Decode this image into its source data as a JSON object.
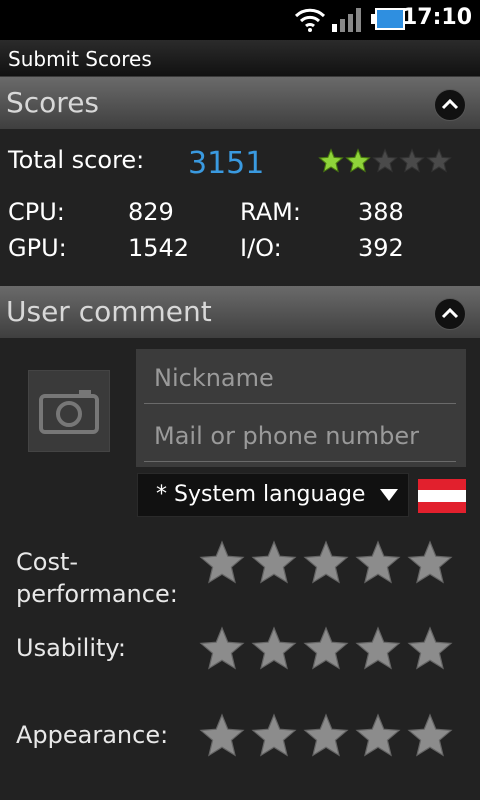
{
  "statusbar": {
    "time": "17:10"
  },
  "title": "Submit Scores",
  "scores": {
    "header": "Scores",
    "total_label": "Total score:",
    "total_value": "3151",
    "total_stars_filled": 2,
    "total_stars_max": 5,
    "cpu_label": "CPU:",
    "cpu_value": "829",
    "ram_label": "RAM:",
    "ram_value": "388",
    "gpu_label": "GPU:",
    "gpu_value": "1542",
    "io_label": "I/O:",
    "io_value": "392"
  },
  "comment": {
    "header": "User comment",
    "nickname_placeholder": "Nickname",
    "contact_placeholder": "Mail or phone number",
    "language": "* System language",
    "ratings": [
      {
        "label_line1": "Cost-",
        "label_line2": "performance:"
      },
      {
        "label_line1": "Usability:",
        "label_line2": ""
      },
      {
        "label_line1": "Appearance:",
        "label_line2": ""
      }
    ]
  },
  "colors": {
    "accent": "#3a9ae0",
    "star_green": "#8fd43a",
    "header_bg": "#555555"
  }
}
